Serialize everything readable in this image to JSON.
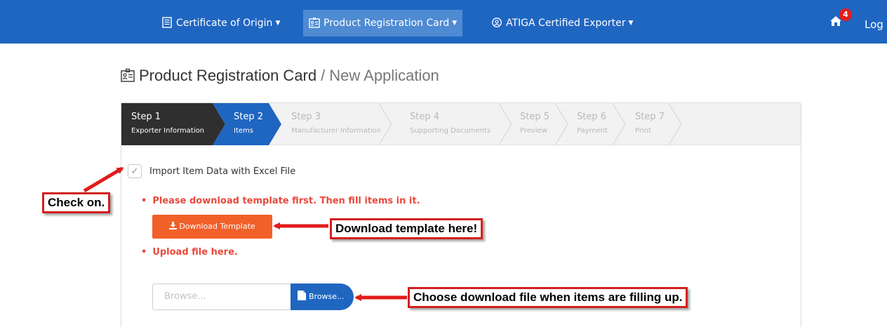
{
  "nav": {
    "items": [
      {
        "label": "Certificate of Origin"
      },
      {
        "label": "Product Registration Card"
      },
      {
        "label": "ATIGA Certified Exporter"
      }
    ],
    "badge": "4",
    "logout": "Log ou"
  },
  "title": {
    "main": "Product Registration Card",
    "separator": "/",
    "sub": "New Application"
  },
  "steps": [
    {
      "num": "Step 1",
      "label": "Exporter Information",
      "state": "done"
    },
    {
      "num": "Step 2",
      "label": "Items",
      "state": "current"
    },
    {
      "num": "Step 3",
      "label": "Manufacturer Information",
      "state": "todo"
    },
    {
      "num": "Step 4",
      "label": "Supporting Documents",
      "state": "todo"
    },
    {
      "num": "Step 5",
      "label": "Preview",
      "state": "todo"
    },
    {
      "num": "Step 6",
      "label": "Payment",
      "state": "todo"
    },
    {
      "num": "Step 7",
      "label": "Print",
      "state": "todo"
    }
  ],
  "form": {
    "checkbox_label": "Import Item Data with Excel File",
    "note1": "Please download template first. Then fill items in it.",
    "download_button": "Download Template",
    "note2": "Upload file here.",
    "file_placeholder": "Browse...",
    "browse_button": "Browse..."
  },
  "callouts": {
    "check": "Check on.",
    "download": "Download template here!",
    "choose": "Choose download file when items are filling up."
  },
  "colors": {
    "navbar": "#1f66c1",
    "step_current": "#1f66c1",
    "step_done": "#2f2f2f",
    "download_button": "#f2602a",
    "note_text": "#e8493b",
    "callout_border": "#d22020"
  },
  "icons": {
    "certificate": "document-icon",
    "registration": "id-card-icon",
    "exporter": "badge-icon",
    "home": "home-icon",
    "download": "download-icon",
    "file": "file-icon",
    "check": "checkmark-icon"
  }
}
